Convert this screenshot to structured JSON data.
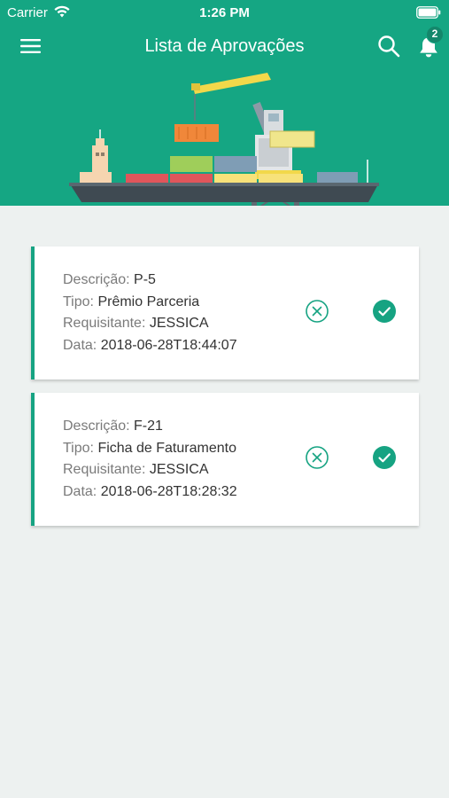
{
  "status_bar": {
    "carrier": "Carrier",
    "time": "1:26 PM"
  },
  "navbar": {
    "title": "Lista de Aprovações",
    "notification_count": "2"
  },
  "icons": {
    "menu": "hamburger-menu-icon",
    "search": "search-icon",
    "notifications": "bell-icon",
    "reject": "x-circle-icon",
    "approve": "check-circle-icon"
  },
  "colors": {
    "primary": "#15a683",
    "background": "#edf1f0",
    "card_accent": "#16a382"
  },
  "labels": {
    "descricao": "Descrição:",
    "tipo": "Tipo:",
    "requisitante": "Requisitante:",
    "data": "Data:"
  },
  "approvals": [
    {
      "descricao": "P-5",
      "tipo": "Prêmio Parceria",
      "requisitante": "JESSICA",
      "data": "2018-06-28T18:44:07"
    },
    {
      "descricao": "F-21",
      "tipo": "Ficha de Faturamento",
      "requisitante": "JESSICA",
      "data": "2018-06-28T18:28:32"
    }
  ]
}
